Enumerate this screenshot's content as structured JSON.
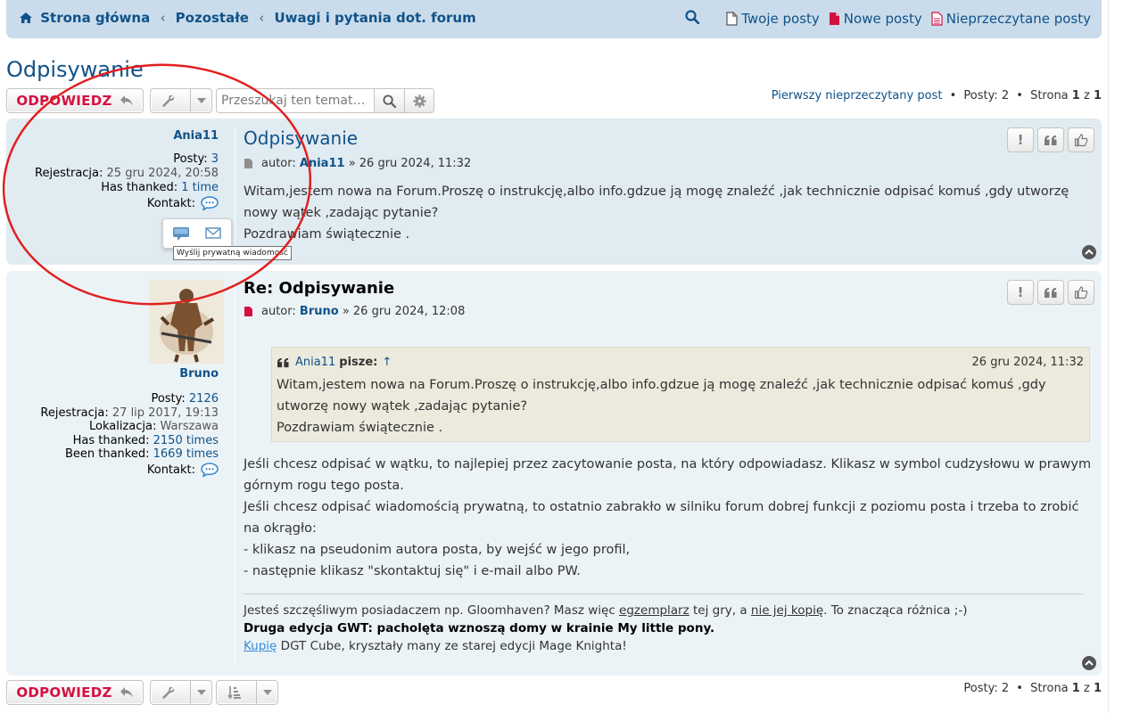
{
  "nav": {
    "crumbs": [
      "Strona główna",
      "Pozostałe",
      "Uwagi i pytania dot. forum"
    ],
    "your_posts": "Twoje posty",
    "new_posts": "Nowe posty",
    "unread_posts": "Nieprzeczytane posty",
    "home_icon": "home-icon",
    "search_icon": "search-icon"
  },
  "topic": {
    "title": "Odpisywanie",
    "reply_label": "ODPOWIEDZ",
    "search_placeholder": "Przeszukaj ten temat…",
    "first_unread": "Pierwszy nieprzeczytany post",
    "posts_label": "Posty:",
    "posts_count": "2",
    "page_label": "Strona",
    "page_current": "1",
    "page_of": "z",
    "page_total": "1",
    "separator": "•",
    "accent_color": "#d31141",
    "link_color": "#105289"
  },
  "posts": [
    {
      "username": "Ania11",
      "posts_label": "Posty:",
      "posts_value": "3",
      "reg_label": "Rejestracja:",
      "reg_value": "25 gru 2024, 20:58",
      "thanked_label": "Has thanked:",
      "thanked_value": "1 time",
      "contact_label": "Kontakt:",
      "title": "Odpisywanie",
      "meta_prefix": "autor:",
      "meta_author": "Ania11",
      "meta_date": "» 26 gru 2024, 11:32",
      "body": [
        "Witam,jestem nowa na Forum.Proszę o instrukcję,albo info.gdzue ją mogę znaleźć ,jak technicznie odpisać komuś ,gdy utworzę nowy wątek ,zadając pytanie?",
        "Pozdrawiam świątecznie ."
      ],
      "tooltip": "Wyślij prywatną wiadomość"
    },
    {
      "username": "Bruno",
      "posts_label": "Posty:",
      "posts_value": "2126",
      "reg_label": "Rejestracja:",
      "reg_value": "27 lip 2017, 19:13",
      "location_label": "Lokalizacja:",
      "location_value": "Warszawa",
      "thanked_label": "Has thanked:",
      "thanked_value": "2150 times",
      "been_thanked_label": "Been thanked:",
      "been_thanked_value": "1669 times",
      "contact_label": "Kontakt:",
      "title": "Re: Odpisywanie",
      "meta_prefix": "autor:",
      "meta_author": "Bruno",
      "meta_date": "» 26 gru 2024, 12:08",
      "quote": {
        "author": "Ania11",
        "says": "pisze:",
        "arrow": "↑",
        "date": "26 gru 2024, 11:32",
        "lines": [
          "Witam,jestem nowa na Forum.Proszę o instrukcję,albo info.gdzue ją mogę znaleźć ,jak technicznie odpisać komuś ,gdy utworzę nowy wątek ,zadając pytanie?",
          "Pozdrawiam świątecznie ."
        ]
      },
      "body": [
        "Jeśli chcesz odpisać w wątku, to najlepiej przez zacytowanie posta, na który odpowiadasz. Klikasz w symbol cudzysłowu w prawym górnym rogu tego posta.",
        "Jeśli chcesz odpisać wiadomością prywatną, to ostatnio zabrakło w silniku forum dobrej funkcji z poziomu posta i trzeba to zrobić na okrągło:",
        "- klikasz na pseudonim autora posta, by wejść w jego profil,",
        "- następnie klikasz \"skontaktuj się\" i e-mail albo PW."
      ],
      "signature": {
        "line1_a": "Jesteś szczęśliwym posiadaczem np. Gloomhaven? Masz więc",
        "line1_u1": "egzemplarz",
        "line1_b": "tej gry, a",
        "line1_u2": "nie jej kopię",
        "line1_c": ". To znacząca różnica ;-)",
        "line2": "Druga edycja GWT: pacholęta wznoszą domy w krainie My little pony.",
        "line3_link": "Kupię",
        "line3_rest": "DGT Cube, kryształy many ze starej edycji Mage Knighta!"
      }
    }
  ]
}
